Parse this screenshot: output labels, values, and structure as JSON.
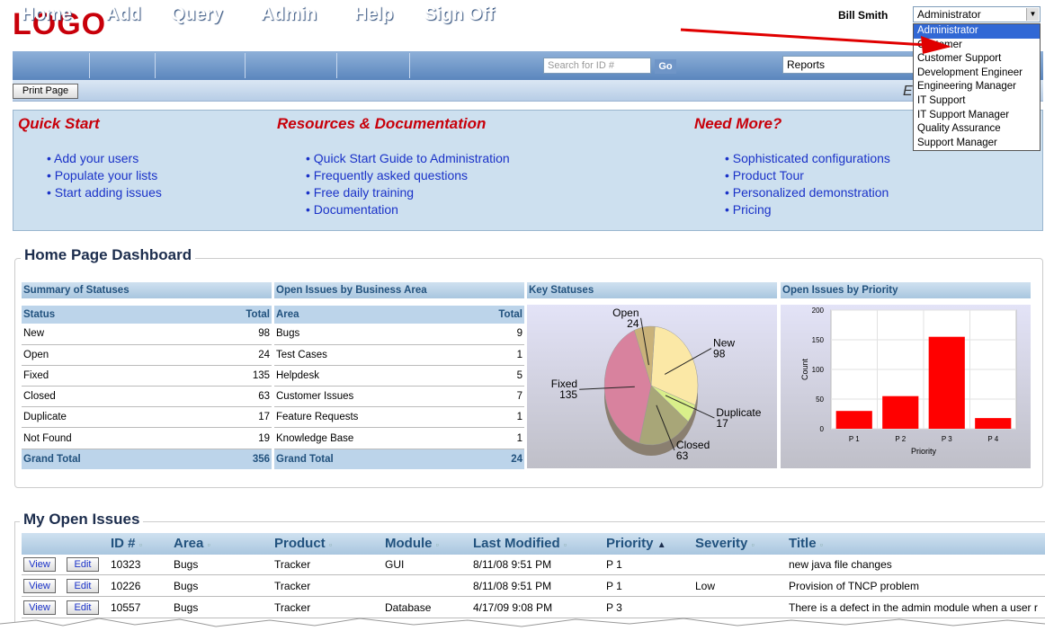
{
  "brand": {
    "logo": "LOGO"
  },
  "user": {
    "name": "Bill Smith",
    "role": "Administrator"
  },
  "role_options": [
    "Administrator",
    "Customer",
    "Customer Support",
    "Development Engineer",
    "Engineering Manager",
    "IT Support",
    "IT Support Manager",
    "Quality Assurance",
    "Support Manager"
  ],
  "nav": {
    "items": [
      "Home",
      "Add",
      "Query",
      "Admin",
      "Help",
      "Sign Off"
    ],
    "search_placeholder": "Search for ID #",
    "go_label": "Go",
    "reports_label": "Reports"
  },
  "toolbar": {
    "print_label": "Print Page",
    "truncated_text": "E"
  },
  "quick_start": {
    "sections": [
      {
        "title": "Quick Start",
        "links": [
          "Add your users",
          "Populate your lists",
          "Start adding issues"
        ]
      },
      {
        "title": "Resources & Documentation",
        "links": [
          "Quick Start Guide to Administration",
          "Frequently asked questions",
          "Free daily training",
          "Documentation"
        ]
      },
      {
        "title": "Need More?",
        "links": [
          "Sophisticated configurations",
          "Product Tour",
          "Personalized demonstration",
          "Pricing"
        ]
      }
    ]
  },
  "dashboard": {
    "title": "Home Page Dashboard",
    "summary": {
      "title": "Summary of Statuses",
      "columns": [
        "Status",
        "Total"
      ],
      "rows": [
        [
          "New",
          "98"
        ],
        [
          "Open",
          "24"
        ],
        [
          "Fixed",
          "135"
        ],
        [
          "Closed",
          "63"
        ],
        [
          "Duplicate",
          "17"
        ],
        [
          "Not Found",
          "19"
        ]
      ],
      "grand_total_label": "Grand Total",
      "grand_total": "356"
    },
    "business_area": {
      "title": "Open Issues by Business Area",
      "columns": [
        "Area",
        "Total"
      ],
      "rows": [
        [
          "Bugs",
          "9"
        ],
        [
          "Test Cases",
          "1"
        ],
        [
          "Helpdesk",
          "5"
        ],
        [
          "Customer Issues",
          "7"
        ],
        [
          "Feature Requests",
          "1"
        ],
        [
          "Knowledge Base",
          "1"
        ]
      ],
      "grand_total_label": "Grand Total",
      "grand_total": "24"
    },
    "key_statuses_title": "Key Statuses",
    "priority_title": "Open Issues by Priority"
  },
  "chart_data": [
    {
      "type": "pie",
      "title": "Key Statuses",
      "categories": [
        "New",
        "Duplicate",
        "Closed",
        "Fixed",
        "Open"
      ],
      "values": [
        98,
        17,
        63,
        135,
        24
      ],
      "colors": [
        "#fbe8a6",
        "#d9ef8a",
        "#a8a678",
        "#d8829e",
        "#c9b27a"
      ]
    },
    {
      "type": "bar",
      "title": "Open Issues by Priority",
      "categories": [
        "P1",
        "P2",
        "P3",
        "P4"
      ],
      "values": [
        30,
        55,
        155,
        18
      ],
      "xlabel": "Priority",
      "ylabel": "Count",
      "ylim": [
        0,
        200
      ],
      "yticks": [
        "0",
        "50",
        "100",
        "150",
        "200"
      ],
      "xtick_labels": [
        "P 1",
        "P 2",
        "P 3",
        "P 4"
      ],
      "bar_color": "#ff0000"
    }
  ],
  "my_issues": {
    "title": "My Open Issues",
    "columns": [
      "ID #",
      "Area",
      "Product",
      "Module",
      "Last Modified",
      "Priority",
      "Severity",
      "Title"
    ],
    "view_label": "View",
    "edit_label": "Edit",
    "rows": [
      {
        "id": "10323",
        "area": "Bugs",
        "product": "Tracker",
        "module": "GUI",
        "modified": "8/11/08 9:51 PM",
        "priority": "P 1",
        "severity": "",
        "title": "new java file changes"
      },
      {
        "id": "10226",
        "area": "Bugs",
        "product": "Tracker",
        "module": "",
        "modified": "8/11/08 9:51 PM",
        "priority": "P 1",
        "severity": "Low",
        "title": "Provision of TNCP problem"
      },
      {
        "id": "10557",
        "area": "Bugs",
        "product": "Tracker",
        "module": "Database",
        "modified": "4/17/09 9:08 PM",
        "priority": "P 3",
        "severity": "",
        "title": "There is a defect in the admin module when a user r"
      }
    ]
  },
  "colors": {
    "brand_red": "#c8000a",
    "nav_blue": "#5b86bd",
    "link_blue": "#1a32c8",
    "highlight": "#3168d5",
    "arrow_red": "#e00000"
  }
}
